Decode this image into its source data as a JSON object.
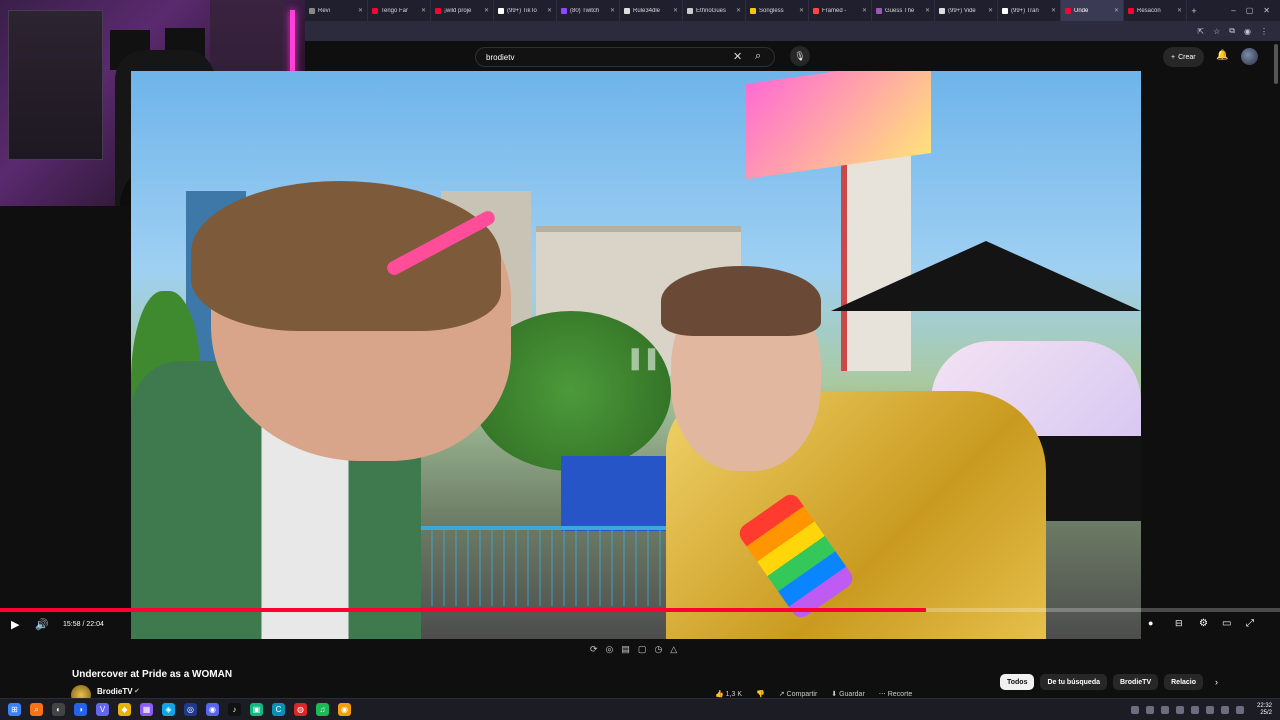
{
  "browser": {
    "tabs": [
      {
        "label": "Revi",
        "color": "#888888",
        "active": false
      },
      {
        "label": "Tengo Far",
        "color": "#ff0033",
        "active": false
      },
      {
        "label": "¡wild proje",
        "color": "#ff0033",
        "active": false
      },
      {
        "label": "(99+) TikTo",
        "color": "#ffffff",
        "active": false
      },
      {
        "label": "(80) Twitch",
        "color": "#9146ff",
        "active": false
      },
      {
        "label": "Rule34dle",
        "color": "#dddddd",
        "active": false
      },
      {
        "label": "EthnoGues",
        "color": "#cccccc",
        "active": false
      },
      {
        "label": "Songless",
        "color": "#f5c518",
        "active": false
      },
      {
        "label": "Framed -",
        "color": "#ff4444",
        "active": false
      },
      {
        "label": "Guess The",
        "color": "#9b59b6",
        "active": false
      },
      {
        "label": "(99+) Vide",
        "color": "#dddddd",
        "active": false
      },
      {
        "label": "(99+) Tran",
        "color": "#ffffff",
        "active": false
      },
      {
        "label": "Unde",
        "color": "#ff0033",
        "active": true
      },
      {
        "label": "Resacón",
        "color": "#ff0033",
        "active": false
      }
    ],
    "new_tab": "+",
    "window_controls": [
      "–",
      "▢",
      "✕"
    ],
    "toolbar_icons": [
      "⇱",
      "☆",
      "⧉",
      "◉",
      "⋮"
    ]
  },
  "youtube": {
    "search_value": "brodietv",
    "clear_icon": "✕",
    "search_icon": "⌕",
    "mic_icon": "🎙",
    "create_label": "Crear",
    "create_icon": "+",
    "bell_icon": "🔔"
  },
  "player": {
    "time_display": "15:58 / 22:04",
    "progress_fraction": 0.7236,
    "play_icon": "▶",
    "volume_icon": "🔊",
    "pause_overlay": "❚❚",
    "right_controls": [
      "●",
      "⊟",
      "⚙",
      "▭",
      "⤢"
    ]
  },
  "extension_icons": [
    "⟳",
    "◎",
    "▤",
    "▢",
    "◷",
    "△"
  ],
  "video": {
    "title": "Undercover at Pride as a WOMAN",
    "channel": "BrodieTV",
    "verified_icon": "✔"
  },
  "actions": [
    "👍 1,3 K",
    "👎",
    "↗ Compartir",
    "⬇ Guardar",
    "⋯ Recorte"
  ],
  "chips": [
    {
      "label": "Todos",
      "active": true
    },
    {
      "label": "De tu búsqueda",
      "active": false
    },
    {
      "label": "BrodieTV",
      "active": false
    },
    {
      "label": "Relacio",
      "active": false
    }
  ],
  "chips_next_icon": "›",
  "taskbar": {
    "apps": [
      {
        "icon": "windows-icon",
        "glyph": "⊞",
        "color": "#3b82f6"
      },
      {
        "icon": "search-icon",
        "glyph": "⌕",
        "color": "#f97316"
      },
      {
        "icon": "app-icon",
        "glyph": "◐",
        "color": "#444444"
      },
      {
        "icon": "app-icon",
        "glyph": "◑",
        "color": "#2563eb"
      },
      {
        "icon": "app-icon",
        "glyph": "V",
        "color": "#6366f1"
      },
      {
        "icon": "app-icon",
        "glyph": "◆",
        "color": "#eab308"
      },
      {
        "icon": "app-icon",
        "glyph": "▦",
        "color": "#8b5cf6"
      },
      {
        "icon": "app-icon",
        "glyph": "◈",
        "color": "#0ea5e9"
      },
      {
        "icon": "steam-icon",
        "glyph": "◎",
        "color": "#1e3a8a"
      },
      {
        "icon": "discord-icon",
        "glyph": "◉",
        "color": "#5865f2"
      },
      {
        "icon": "tiktok-icon",
        "glyph": "♪",
        "color": "#111111"
      },
      {
        "icon": "app-icon",
        "glyph": "▣",
        "color": "#10b981"
      },
      {
        "icon": "app-icon",
        "glyph": "C",
        "color": "#0891b2"
      },
      {
        "icon": "app-icon",
        "glyph": "◍",
        "color": "#dc2626"
      },
      {
        "icon": "spotify-icon",
        "glyph": "♫",
        "color": "#1db954"
      },
      {
        "icon": "chrome-icon",
        "glyph": "◉",
        "color": "#f59e0b"
      }
    ],
    "time": "22:32",
    "date": "25/2"
  }
}
